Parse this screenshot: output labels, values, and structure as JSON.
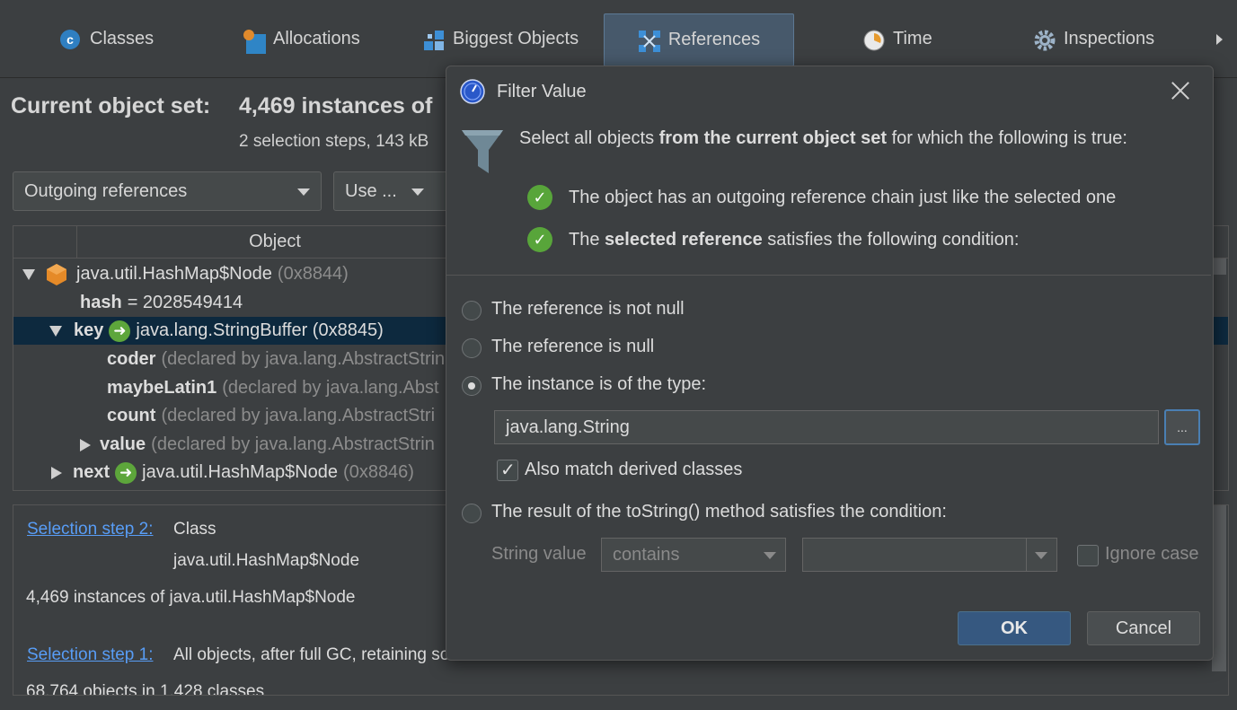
{
  "toolbar": {
    "tabs": [
      {
        "label": "Classes",
        "icon": "classes-icon"
      },
      {
        "label": "Allocations",
        "icon": "allocations-icon"
      },
      {
        "label": "Biggest Objects",
        "icon": "biggest-objects-icon"
      },
      {
        "label": "References",
        "icon": "references-icon",
        "active": true
      },
      {
        "label": "Time",
        "icon": "time-icon"
      },
      {
        "label": "Inspections",
        "icon": "inspections-icon"
      }
    ]
  },
  "object_set": {
    "title": "Current object set:",
    "value": "4,469 instances of",
    "subtitle": "2 selection steps, 143 kB"
  },
  "controls": {
    "reference_mode": "Outgoing references",
    "use_button": "Use ..."
  },
  "tree": {
    "column_header": "Object",
    "rows": [
      {
        "name": "",
        "text": "java.util.HashMap$Node",
        "dim": "(0x8844)"
      },
      {
        "name": "hash",
        "text": "= 2028549414",
        "dim": ""
      },
      {
        "name": "key",
        "text": "java.lang.StringBuffer (0x8845)",
        "dim": ""
      },
      {
        "name": "coder",
        "text": "",
        "dim": "(declared by java.lang.AbstractStrin"
      },
      {
        "name": "maybeLatin1",
        "text": "",
        "dim": "(declared by java.lang.Abst"
      },
      {
        "name": "count",
        "text": "",
        "dim": "(declared by java.lang.AbstractStri"
      },
      {
        "name": "value",
        "text": "",
        "dim": "(declared by java.lang.AbstractStrin"
      },
      {
        "name": "next",
        "text": "java.util.HashMap$Node",
        "dim": "(0x8846)"
      }
    ]
  },
  "steps": {
    "step2_link": "Selection step 2:",
    "step2_kind": "Class",
    "step2_class": "java.util.HashMap$Node",
    "step2_summary": "4,469 instances of java.util.HashMap$Node",
    "step1_link": "Selection step 1:",
    "step1_desc": "All objects, after full GC, retaining soft",
    "step1_summary": "68,764 objects in 1,428 classes"
  },
  "dialog": {
    "title": "Filter Value",
    "intro_prefix": "Select all objects",
    "intro_bold": "from the current object set",
    "intro_suffix": "for which the following is true:",
    "cond1": "The object has an outgoing reference chain just like the selected one",
    "cond2_prefix": "The",
    "cond2_bold": "selected reference",
    "cond2_suffix": "satisfies the following condition:",
    "options": {
      "not_null": "The reference is not null",
      "is_null": "The reference is null",
      "of_type": "The instance is of the type:",
      "to_string": "The result of the toString() method satisfies the condition:"
    },
    "selected_option": "of_type",
    "type_value": "java.lang.String",
    "browse_label": "...",
    "derived_label": "Also match derived classes",
    "derived_checked": true,
    "string_value_label": "String value",
    "operator": "contains",
    "string_input": "",
    "ignore_case_label": "Ignore case",
    "ignore_case_checked": false,
    "ok_label": "OK",
    "cancel_label": "Cancel"
  },
  "colors": {
    "background": "#3c3f41",
    "active_tab": "#47596b",
    "selection_row": "#0d293e",
    "link": "#589df6",
    "ok_button": "#365880",
    "check_green": "#58a53a"
  }
}
